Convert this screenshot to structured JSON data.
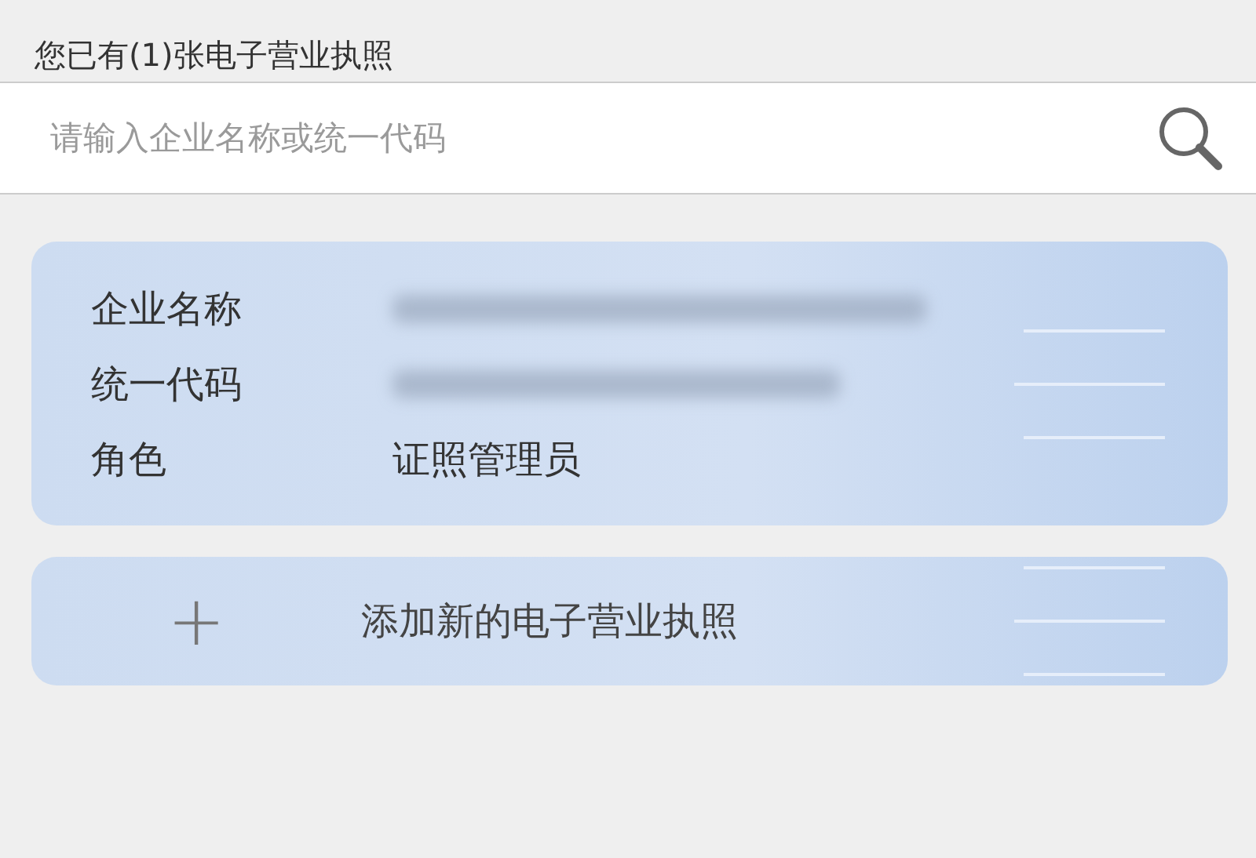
{
  "header": {
    "title": "您已有(1)张电子营业执照"
  },
  "search": {
    "placeholder": "请输入企业名称或统一代码"
  },
  "license_card": {
    "rows": [
      {
        "label": "企业名称",
        "kind": "blurred"
      },
      {
        "label": "统一代码",
        "kind": "blurred"
      },
      {
        "label": "角色",
        "kind": "text",
        "value": "证照管理员"
      }
    ]
  },
  "add_card": {
    "icon": "+",
    "label": "添加新的电子营业执照"
  }
}
